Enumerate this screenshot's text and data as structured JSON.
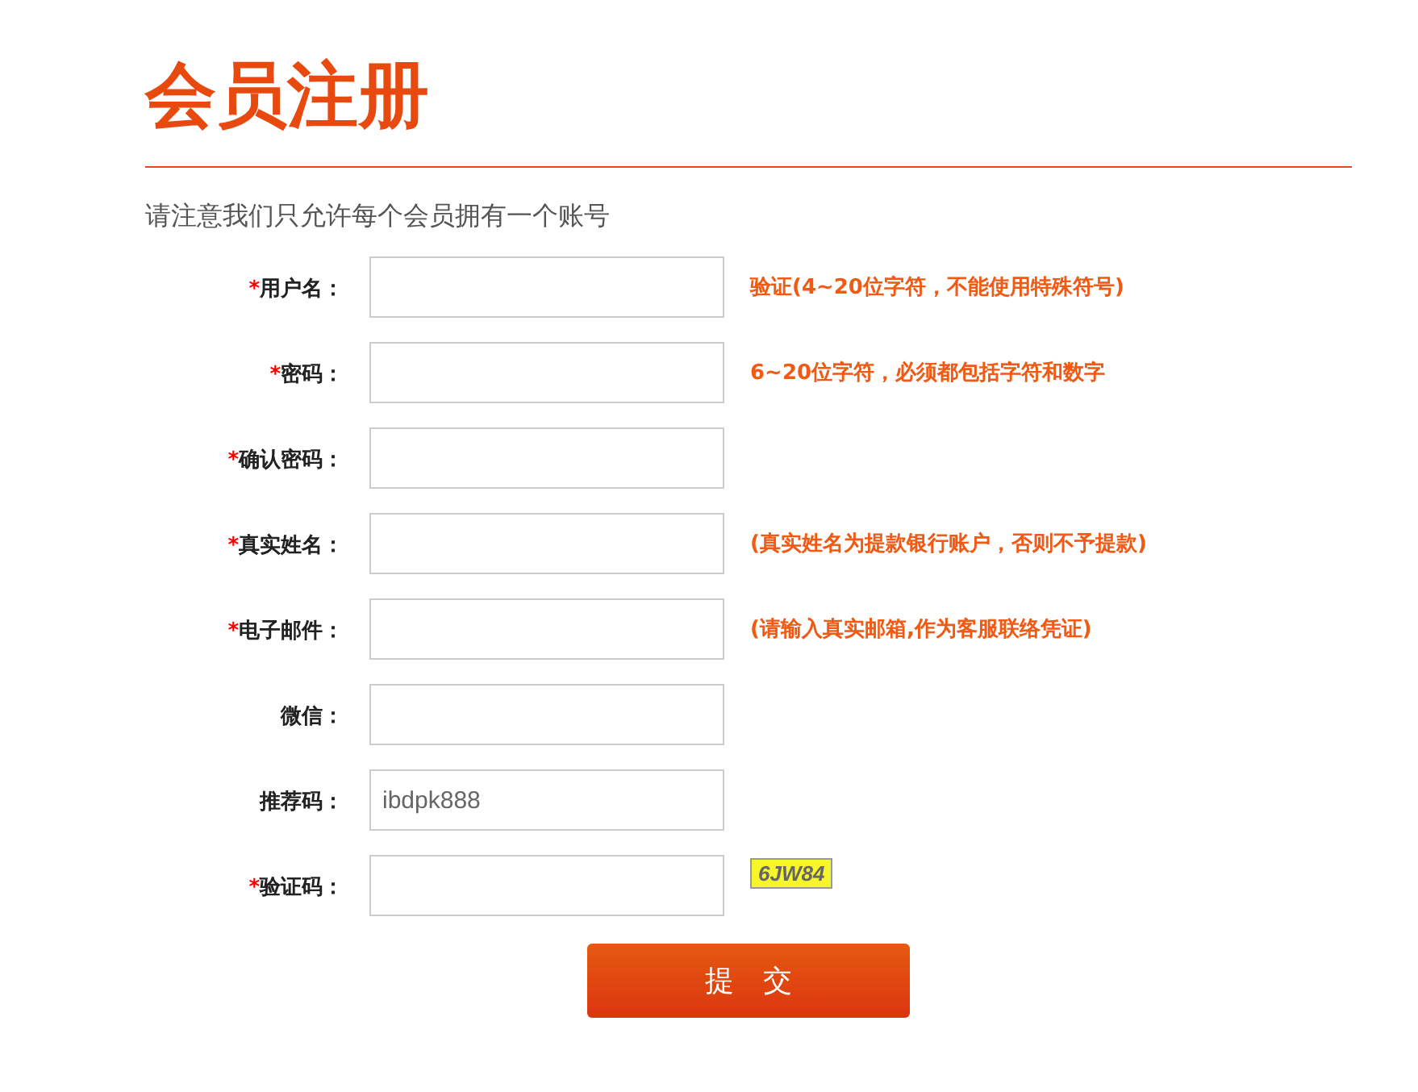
{
  "title": "会员注册",
  "notice": "请注意我们只允许每个会员拥有一个账号",
  "fields": [
    {
      "label": "用户名：",
      "required_mark": "*",
      "hint": "验证(4~20位字符，不能使用特殊符号)"
    },
    {
      "label": "密码：",
      "required_mark": "*",
      "hint": "6~20位字符，必须都包括字符和数字"
    },
    {
      "label": "确认密码：",
      "required_mark": "*"
    },
    {
      "label": "真实姓名：",
      "required_mark": "*",
      "hint": "(真实姓名为提款银行账户，否则不予提款)"
    },
    {
      "label": "电子邮件：",
      "required_mark": "*",
      "hint": "(请输入真实邮箱,作为客服联络凭证)"
    },
    {
      "label": "微信："
    },
    {
      "label": "推荐码：",
      "value": "ibdpk888"
    },
    {
      "label": "验证码：",
      "required_mark": "*",
      "captcha": "6JW84"
    }
  ],
  "submit": "提　交"
}
